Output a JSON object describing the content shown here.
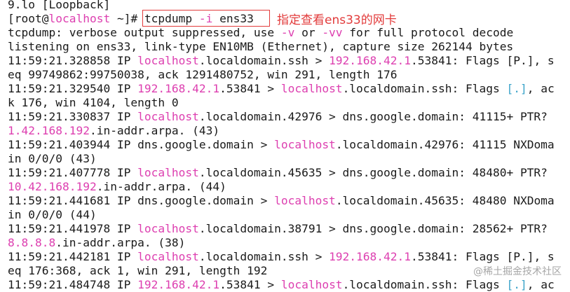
{
  "terminal": {
    "lines": [
      {
        "segments": [
          {
            "t": "9.lo [Loopback]"
          }
        ]
      },
      {
        "segments": [
          {
            "t": "[root@"
          },
          {
            "t": "localhost",
            "c": "pink"
          },
          {
            "t": " ~]# "
          },
          {
            "t": "tcpdump "
          },
          {
            "t": "-i",
            "c": "pink"
          },
          {
            "t": " ens33"
          }
        ]
      },
      {
        "segments": [
          {
            "t": "tcpdump: verbose output suppressed, use "
          },
          {
            "t": "-v",
            "c": "pink"
          },
          {
            "t": " or "
          },
          {
            "t": "-vv",
            "c": "pink"
          },
          {
            "t": " for full protocol decode"
          }
        ]
      },
      {
        "segments": [
          {
            "t": "listening on ens33, link-type EN10MB (Ethernet), capture size 262144 bytes"
          }
        ]
      },
      {
        "segments": [
          {
            "t": "11:59:21.328858 IP "
          },
          {
            "t": "localhost",
            "c": "pink"
          },
          {
            "t": ".localdomain.ssh > "
          },
          {
            "t": "192.168.42.1",
            "c": "pink"
          },
          {
            "t": ".53841: Flags [P.], s"
          }
        ]
      },
      {
        "segments": [
          {
            "t": "eq 99749862:99750038, ack 1291480752, win 291, length 176"
          }
        ]
      },
      {
        "segments": [
          {
            "t": "11:59:21.329540 IP "
          },
          {
            "t": "192.168.42.1",
            "c": "pink"
          },
          {
            "t": ".53841 > "
          },
          {
            "t": "localhost",
            "c": "pink"
          },
          {
            "t": ".localdomain.ssh: Flags "
          },
          {
            "t": "[.]",
            "c": "cyan"
          },
          {
            "t": ", ac"
          }
        ]
      },
      {
        "segments": [
          {
            "t": "k 176, win 4104, length 0"
          }
        ]
      },
      {
        "segments": [
          {
            "t": "11:59:21.330837 IP "
          },
          {
            "t": "localhost",
            "c": "pink"
          },
          {
            "t": ".localdomain.42976 > dns.google.domain: 41115+ PTR?"
          }
        ]
      },
      {
        "segments": [
          {
            "t": "1.42.168.192",
            "c": "pink"
          },
          {
            "t": ".in-addr.arpa. (43)"
          }
        ]
      },
      {
        "segments": [
          {
            "t": "11:59:21.403944 IP dns.google.domain > "
          },
          {
            "t": "localhost",
            "c": "pink"
          },
          {
            "t": ".localdomain.42976: 41115 NXDoma"
          }
        ]
      },
      {
        "segments": [
          {
            "t": "in 0/0/0 (43)"
          }
        ]
      },
      {
        "segments": [
          {
            "t": "11:59:21.407778 IP "
          },
          {
            "t": "localhost",
            "c": "pink"
          },
          {
            "t": ".localdomain.45635 > dns.google.domain: 48480+ PTR?"
          }
        ]
      },
      {
        "segments": [
          {
            "t": "10.42.168.192",
            "c": "pink"
          },
          {
            "t": ".in-addr.arpa. (44)"
          }
        ]
      },
      {
        "segments": [
          {
            "t": "11:59:21.441681 IP dns.google.domain > "
          },
          {
            "t": "localhost",
            "c": "pink"
          },
          {
            "t": ".localdomain.45635: 48480 NXDoma"
          }
        ]
      },
      {
        "segments": [
          {
            "t": "in 0/0/0 (44)"
          }
        ]
      },
      {
        "segments": [
          {
            "t": "11:59:21.441978 IP "
          },
          {
            "t": "localhost",
            "c": "pink"
          },
          {
            "t": ".localdomain.38791 > dns.google.domain: 28562+ PTR?"
          }
        ]
      },
      {
        "segments": [
          {
            "t": "8.8.8.8",
            "c": "pink"
          },
          {
            "t": ".in-addr.arpa. (38)"
          }
        ]
      },
      {
        "segments": [
          {
            "t": "11:59:21.442181 IP "
          },
          {
            "t": "localhost",
            "c": "pink"
          },
          {
            "t": ".localdomain.ssh > "
          },
          {
            "t": "192.168.42.1",
            "c": "pink"
          },
          {
            "t": ".53841: Flags [P.], s"
          }
        ]
      },
      {
        "segments": [
          {
            "t": "eq 176:368, ack 1, win 291, length 192"
          }
        ]
      },
      {
        "segments": [
          {
            "t": "11:59:21.484748 IP "
          },
          {
            "t": "192.168.42.1",
            "c": "pink"
          },
          {
            "t": ".53841 > "
          },
          {
            "t": "localhost",
            "c": "pink"
          },
          {
            "t": ".localdomain.ssh: Flags "
          },
          {
            "t": "[.]",
            "c": "cyan"
          },
          {
            "t": ", ac"
          }
        ]
      }
    ]
  },
  "annotation": {
    "text": "指定查看ens33的网卡"
  },
  "watermark": {
    "text": "@稀土掘金技术社区"
  },
  "colors": {
    "highlight": "#dd3fb0",
    "flag": "#3aa3c9",
    "annotation": "#e23b3b"
  }
}
